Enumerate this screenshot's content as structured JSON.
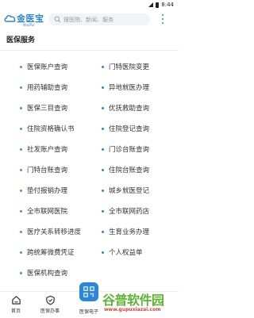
{
  "status_bar": {
    "time": "8:44"
  },
  "header": {
    "brand": "金医宝",
    "brand_sub": "MedPal",
    "search_placeholder": "搜医院、新闻、服务"
  },
  "section": {
    "title": "医保服务"
  },
  "colors": {
    "accent": "#2a86d8",
    "dot_green": "#4caf50",
    "dot_blue": "#2a86d8"
  },
  "services": [
    {
      "left": "医保账户查询",
      "right": "门特医院变更"
    },
    {
      "left": "用药辅助查询",
      "right": "异地就医办理"
    },
    {
      "left": "医保三目查询",
      "right": "优抚救助查询"
    },
    {
      "left": "住院资格确认书",
      "right": "住院登记查询"
    },
    {
      "left": "社发账户查询",
      "right": "门诊台账查询"
    },
    {
      "left": "门特台账查询",
      "right": "住院台账查询"
    },
    {
      "left": "垫付报销办理",
      "right": "城乡就医登记"
    },
    {
      "left": "全市联网医院",
      "right": "全市联网药店"
    },
    {
      "left": "医疗关系转移进度",
      "right": "生育业务办理"
    },
    {
      "left": "跨统筹微费凭证",
      "right": "个人权益单"
    },
    {
      "left": "医保机构查询",
      "right": ""
    }
  ],
  "tabbar": {
    "tabs": [
      {
        "label": "首页",
        "icon": "home-icon"
      },
      {
        "label": "医保办事",
        "icon": "shield-icon"
      },
      {
        "label": "医保电子",
        "icon": "qrcode-icon"
      }
    ]
  },
  "watermark": {
    "text": "谷普软件园",
    "url": "www.gupuxiazai.com"
  }
}
